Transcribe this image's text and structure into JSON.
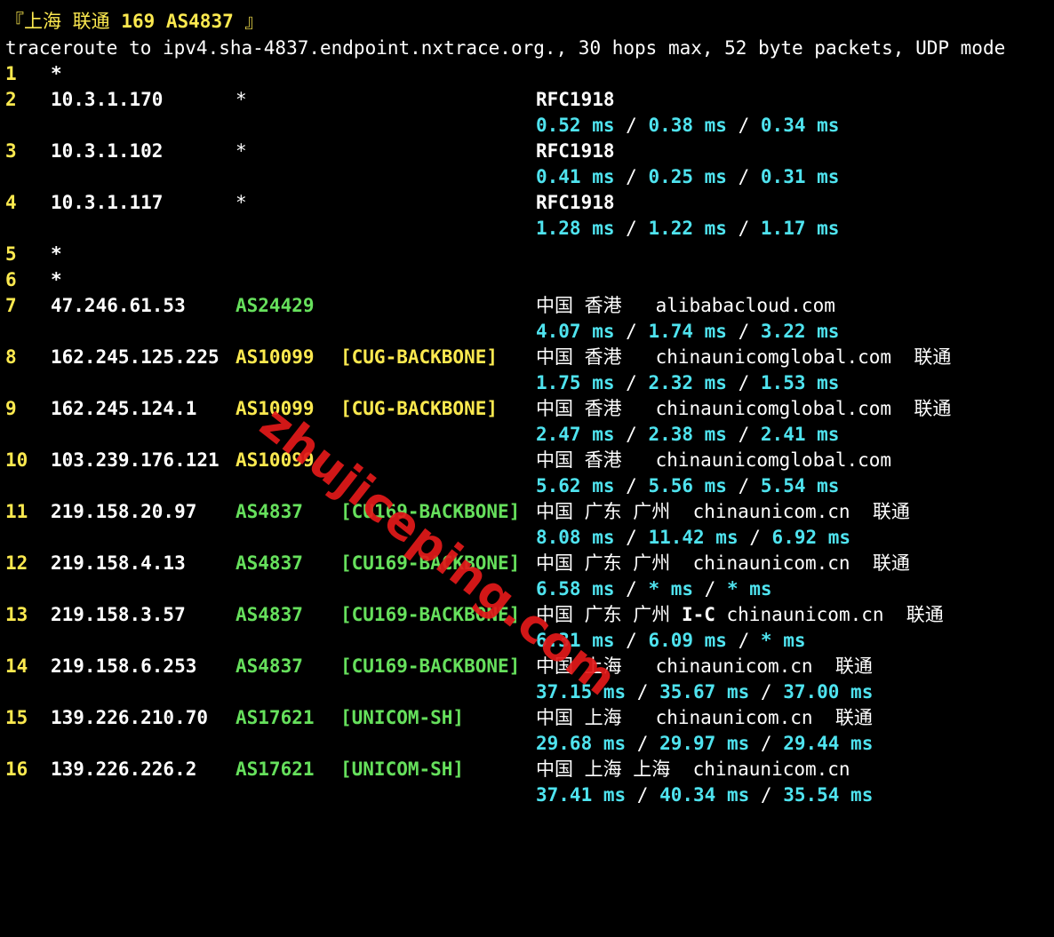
{
  "terminal": {
    "title_prefix": "『上海 联通 ",
    "title_bold": "169 AS4837",
    "title_suffix": " 』",
    "command_line": "traceroute to ipv4.sha-4837.endpoint.nxtrace.org., 30 hops max, 52 byte packets, UDP mode"
  },
  "watermark": "zhujiceping.com",
  "colors": {
    "background": "#000000",
    "yellow": "#fce94f",
    "green": "#66e05c",
    "cyan": "#4fe3ef",
    "watermark_red": "#e3191a"
  },
  "hops": [
    {
      "num": "1",
      "star": "*"
    },
    {
      "num": "2",
      "ip": "10.3.1.170",
      "asn": "*",
      "rfc": "RFC1918",
      "rtt1": "0.52 ms",
      "rtt2": "0.38 ms",
      "rtt3": "0.34 ms"
    },
    {
      "num": "3",
      "ip": "10.3.1.102",
      "asn": "*",
      "rfc": "RFC1918",
      "rtt1": "0.41 ms",
      "rtt2": "0.25 ms",
      "rtt3": "0.31 ms"
    },
    {
      "num": "4",
      "ip": "10.3.1.117",
      "asn": "*",
      "rfc": "RFC1918",
      "rtt1": "1.28 ms",
      "rtt2": "1.22 ms",
      "rtt3": "1.17 ms"
    },
    {
      "num": "5",
      "star": "*"
    },
    {
      "num": "6",
      "star": "*"
    },
    {
      "num": "7",
      "ip": "47.246.61.53",
      "asn": "AS24429",
      "geo": "中国 香港   alibabacloud.com",
      "rtt1": "4.07 ms",
      "rtt2": "1.74 ms",
      "rtt3": "3.22 ms"
    },
    {
      "num": "8",
      "ip": "162.245.125.225",
      "asn": "AS10099",
      "tag": "[CUG-BACKBONE]",
      "geo": "中国 香港   chinaunicomglobal.com  联通",
      "rtt1": "1.75 ms",
      "rtt2": "2.32 ms",
      "rtt3": "1.53 ms"
    },
    {
      "num": "9",
      "ip": "162.245.124.1",
      "asn": "AS10099",
      "tag": "[CUG-BACKBONE]",
      "geo": "中国 香港   chinaunicomglobal.com  联通",
      "rtt1": "2.47 ms",
      "rtt2": "2.38 ms",
      "rtt3": "2.41 ms"
    },
    {
      "num": "10",
      "ip": "103.239.176.121",
      "asn": "AS10099",
      "geo": "中国 香港   chinaunicomglobal.com",
      "rtt1": "5.62 ms",
      "rtt2": "5.56 ms",
      "rtt3": "5.54 ms"
    },
    {
      "num": "11",
      "ip": "219.158.20.97",
      "asn": "AS4837",
      "tag": "[CU169-BACKBONE]",
      "geo": "中国 广东 广州  chinaunicom.cn  联通",
      "rtt1": "8.08 ms",
      "rtt2": "11.42 ms",
      "rtt3": "6.92 ms"
    },
    {
      "num": "12",
      "ip": "219.158.4.13",
      "asn": "AS4837",
      "tag": "[CU169-BACKBONE]",
      "geo": "中国 广东 广州  chinaunicom.cn  联通",
      "rtt1": "6.58 ms",
      "rtt2": "* ms",
      "rtt3": "* ms"
    },
    {
      "num": "13",
      "ip": "219.158.3.57",
      "asn": "AS4837",
      "tag": "[CU169-BACKBONE]",
      "geo_a": "中国 广东 广州 ",
      "geo_b": "I-C",
      "geo_c": " chinaunicom.cn  联通",
      "rtt1": "6.31 ms",
      "rtt2": "6.09 ms",
      "rtt3": "* ms"
    },
    {
      "num": "14",
      "ip": "219.158.6.253",
      "asn": "AS4837",
      "tag": "[CU169-BACKBONE]",
      "geo": "中国 上海   chinaunicom.cn  联通",
      "rtt1": "37.15 ms",
      "rtt2": "35.67 ms",
      "rtt3": "37.00 ms"
    },
    {
      "num": "15",
      "ip": "139.226.210.70",
      "asn": "AS17621",
      "tag": "[UNICOM-SH]",
      "geo": "中国 上海   chinaunicom.cn  联通",
      "rtt1": "29.68 ms",
      "rtt2": "29.97 ms",
      "rtt3": "29.44 ms"
    },
    {
      "num": "16",
      "ip": "139.226.226.2",
      "asn": "AS17621",
      "tag": "[UNICOM-SH]",
      "geo": "中国 上海 上海  chinaunicom.cn",
      "rtt1": "37.41 ms",
      "rtt2": "40.34 ms",
      "rtt3": "35.54 ms"
    }
  ]
}
